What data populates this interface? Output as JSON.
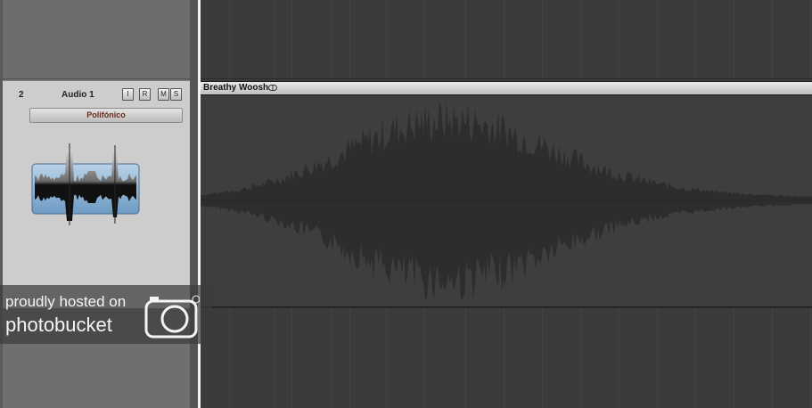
{
  "track": {
    "number": "2",
    "name": "Audio 1",
    "buttons": {
      "input": "I",
      "record": "R",
      "mute": "M",
      "solo": "S"
    },
    "instrument_label": "Polifónico",
    "icon": "audio-waveform-icon"
  },
  "region": {
    "title": "Breathy Woosh",
    "loop_icon": "loop-icon"
  },
  "watermark": {
    "line1": "proudly hosted on",
    "line2": "photobucket",
    "icon": "camera-icon"
  },
  "colors": {
    "track_header_bg": "#cdcdcd",
    "arrange_bg": "#3b3b3b",
    "region_bg": "#3e3e3e",
    "waveform": "#2e2e2e",
    "instrument_text": "#6b2a1a",
    "icon_blue": "#8ab0d0"
  }
}
